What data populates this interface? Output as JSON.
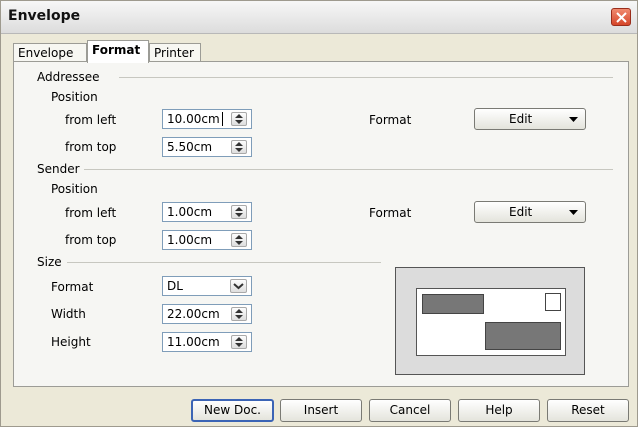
{
  "window": {
    "title": "Envelope"
  },
  "tabs": [
    {
      "label": "Envelope"
    },
    {
      "label": "Format",
      "active": true
    },
    {
      "label": "Printer"
    }
  ],
  "addressee": {
    "heading": "Addressee",
    "position_label": "Position",
    "from_left_label": "from left",
    "from_left_value": "10.00cm",
    "from_top_label": "from top",
    "from_top_value": "5.50cm",
    "format_label": "Format",
    "edit_label": "Edit"
  },
  "sender": {
    "heading": "Sender",
    "position_label": "Position",
    "from_left_label": "from left",
    "from_left_value": "1.00cm",
    "from_top_label": "from top",
    "from_top_value": "1.00cm",
    "format_label": "Format",
    "edit_label": "Edit"
  },
  "size": {
    "heading": "Size",
    "format_label": "Format",
    "format_value": "DL",
    "width_label": "Width",
    "width_value": "22.00cm",
    "height_label": "Height",
    "height_value": "11.00cm"
  },
  "buttons": {
    "new_doc": "New Doc.",
    "insert": "Insert",
    "cancel": "Cancel",
    "help": "Help",
    "reset": "Reset"
  },
  "icons": [
    "close-icon",
    "spin-arrows-icon",
    "dropdown-arrow-icon"
  ],
  "colors": {
    "accent": "#3b64b5",
    "close": "#d5462a",
    "preview_block": "#777777"
  }
}
